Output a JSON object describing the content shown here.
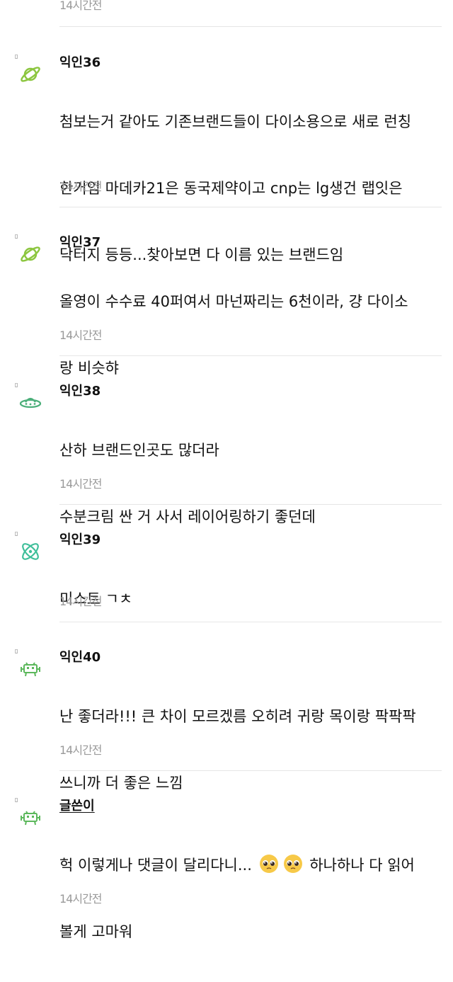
{
  "top_time": "14시간전",
  "comments": [
    {
      "author": "익인36",
      "marker": "▯",
      "avatar_icon": "planet-icon",
      "lines": [
        "첨보는거 같아도 기존브랜드들이 다이소용으로 새로 런칭",
        "한거임 마데카21은 동국제약이고 cnp는 lg생건 랩잇은",
        "닥터지 등등...찾아보면 다 이름 있는 브랜드임"
      ],
      "time": "14시간전"
    },
    {
      "author": "익인37",
      "marker": "▯",
      "avatar_icon": "planet-icon",
      "lines": [
        "올영이 수수료 40퍼여서 마넌짜리는 6천이라, 걍 다이소",
        "랑 비슷햐"
      ],
      "time": "14시간전"
    },
    {
      "author": "익인38",
      "marker": "▯",
      "avatar_icon": "ufo-icon",
      "lines": [
        "산하 브랜드인곳도 많더라",
        "수분크림 싼 거 사서 레이어링하기 좋던데"
      ],
      "time": "14시간전"
    },
    {
      "author": "익인39",
      "marker": "▯",
      "avatar_icon": "atom-icon",
      "lines": [
        "미스트 ㄱㅊ"
      ],
      "time": "14시간전"
    },
    {
      "author": "익인40",
      "marker": "▯",
      "avatar_icon": "space-invader-icon",
      "lines": [
        "난 좋더라!!! 큰 차이 모르겠름 오히려 귀랑 목이랑 팍팍팍",
        "쓰니까 더 좋은 느낌"
      ],
      "time": "14시간전"
    },
    {
      "author": "글쓴이",
      "marker": "▯",
      "avatar_icon": "space-invader-icon",
      "lines": [
        "헉 이렇게나 댓글이 달리다니... ",
        " 하나하나 다 읽어",
        "볼게 고마워"
      ],
      "emoji": "pleading-face-emoji",
      "time": "14시간전"
    }
  ],
  "colors": {
    "planet": "#8cc63f",
    "ufo": "#4caf7a",
    "atom": "#3fbf9a",
    "invader": "#5cb85c",
    "time_text": "#9a9a9a",
    "divider": "#e6e6e6"
  }
}
